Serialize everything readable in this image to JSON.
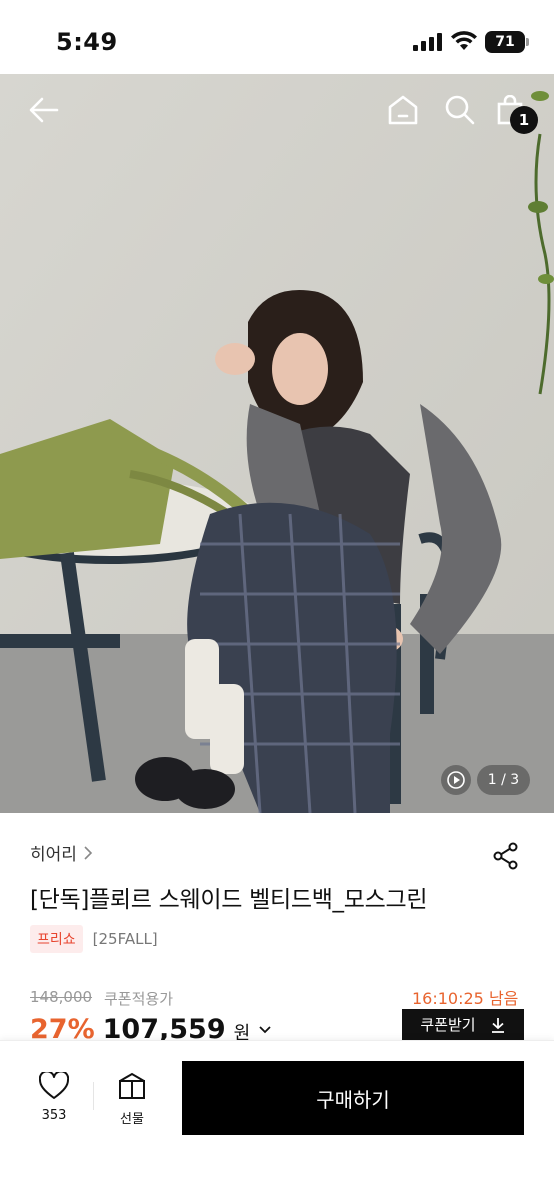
{
  "status_bar": {
    "time": "5:49",
    "battery": "71"
  },
  "header": {
    "cart_count": "1"
  },
  "gallery": {
    "counter": "1 / 3"
  },
  "product": {
    "brand": "히어리",
    "title": "[단독]플뢰르 스웨이드 벨티드백_모스그린",
    "tag_badge": "프리쇼",
    "tag_text": "[25FALL]",
    "original_price": "148,000",
    "coupon_label": "쿠폰적용가",
    "countdown": "16:10:25 남음",
    "discount": "27%",
    "price": "107,559",
    "currency": "원",
    "coupon_button": "쿠폰받기"
  },
  "bottom_bar": {
    "like_count": "353",
    "gift_label": "선물",
    "buy_label": "구매하기"
  },
  "colors": {
    "accent": "#e8642f",
    "badge_bg": "#fdecec",
    "badge_text": "#e8452f",
    "primary": "#000000"
  },
  "icons": [
    "back-arrow-icon",
    "home-icon",
    "search-icon",
    "shopping-bag-icon",
    "play-icon",
    "chevron-right-icon",
    "share-icon",
    "chevron-down-icon",
    "download-icon",
    "heart-icon",
    "gift-icon"
  ]
}
